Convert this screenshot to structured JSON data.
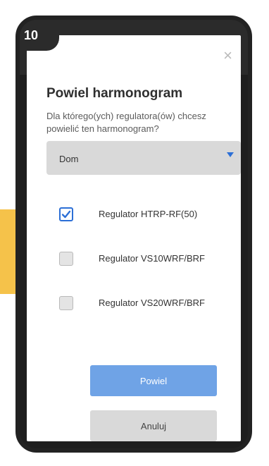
{
  "step": {
    "number": "10"
  },
  "modal": {
    "close_glyph": "×",
    "title": "Powiel harmonogram",
    "subtitle": "Dla którego(ych) regulatora(ów) chcesz powielić ten harmonogram?",
    "select": {
      "value": "Dom"
    },
    "options": [
      {
        "label": "Regulator HTRP-RF(50)",
        "checked": true
      },
      {
        "label": "Regulator VS10WRF/BRF",
        "checked": false
      },
      {
        "label": "Regulator VS20WRF/BRF",
        "checked": false
      }
    ],
    "primary_button": "Powiel",
    "secondary_button": "Anuluj"
  },
  "colors": {
    "accent": "#2c6fd6",
    "primary_button": "#6fa3e6",
    "pointer_arrow": "#f5c24a"
  },
  "icons": [
    "close-icon",
    "chevron-down-icon",
    "checkmark-icon"
  ]
}
